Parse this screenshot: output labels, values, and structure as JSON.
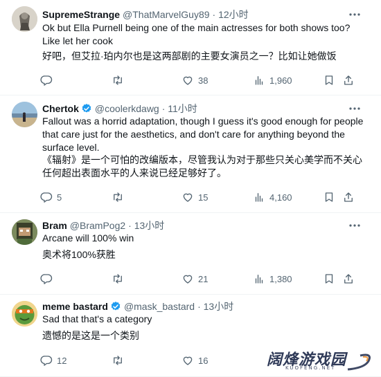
{
  "tweets": [
    {
      "name": "SupremeStrange",
      "handle": "@ThatMarvelGuy89",
      "time": "· 12小时",
      "verified": false,
      "text": "Ok but Ella Purnell being one of the main actresses for both shows too? Like let her cook",
      "translation": "好吧，但艾拉·珀内尔也是这两部剧的主要女演员之一？比如让她做饭",
      "replies": "",
      "likes": "38",
      "views": "1,960"
    },
    {
      "name": "Chertok",
      "handle": "@coolerkdawg",
      "time": "· 11小时",
      "verified": true,
      "text": "Fallout was a horrid adaptation, though I guess it's good enough for people that care just for the aesthetics, and don't care for anything beyond the surface level.",
      "translation": "《辐射》是一个可怕的改编版本，尽管我认为对于那些只关心美学而不关心任何超出表面水平的人来说已经足够好了。",
      "replies": "5",
      "likes": "15",
      "views": "4,160"
    },
    {
      "name": "Bram",
      "handle": "@BramPog2",
      "time": "· 13小时",
      "verified": false,
      "text": "Arcane will 100% win",
      "translation": "奥术将100%获胜",
      "replies": "",
      "likes": "21",
      "views": "1,380"
    },
    {
      "name": "meme bastard",
      "handle": "@mask_bastard",
      "time": "· 13小时",
      "verified": true,
      "text": "Sad that that's a category",
      "translation": "遗憾的是这是一个类别",
      "replies": "12",
      "likes": "16",
      "views": ""
    }
  ],
  "watermark": {
    "title": "阔烽游戏园",
    "sub": "KUOFENG.NET"
  }
}
